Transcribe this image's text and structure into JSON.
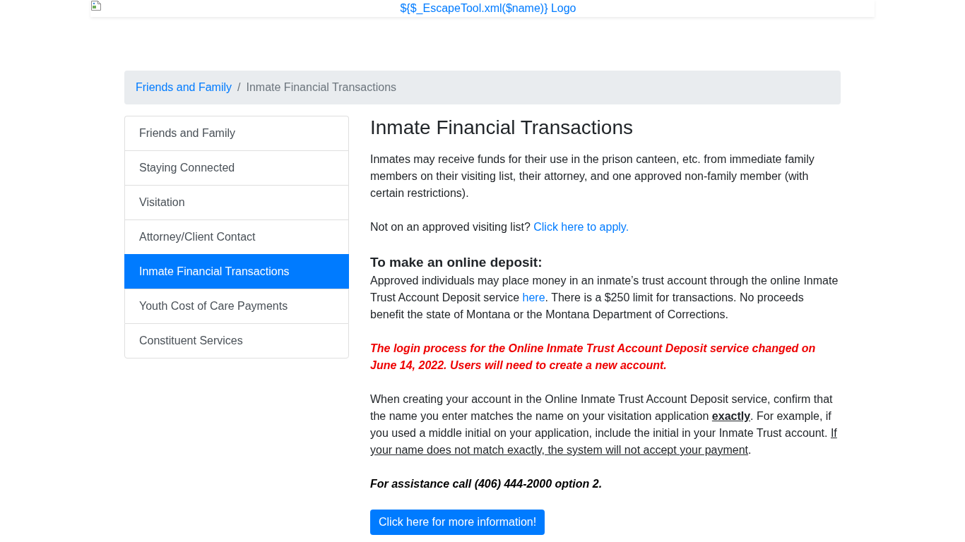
{
  "header": {
    "logo_alt_text": "${$_EscapeTool.xml($name)} Logo"
  },
  "breadcrumb": {
    "separator": "/",
    "items": [
      {
        "label": "Friends and Family",
        "current": false
      },
      {
        "label": "Inmate Financial Transactions",
        "current": true
      }
    ]
  },
  "sidebar": {
    "items": [
      {
        "label": "Friends and Family",
        "selected": false
      },
      {
        "label": "Staying Connected",
        "selected": false
      },
      {
        "label": "Visitation",
        "selected": false
      },
      {
        "label": "Attorney/Client Contact",
        "selected": false
      },
      {
        "label": "Inmate Financial Transactions",
        "selected": true
      },
      {
        "label": "Youth Cost of Care Payments",
        "selected": false
      },
      {
        "label": "Constituent Services",
        "selected": false
      }
    ]
  },
  "content": {
    "title": "Inmate Financial Transactions",
    "blocks": [
      {
        "kind": "paragraph",
        "segments": [
          {
            "kind": "text",
            "text": "Inmates may receive funds for their use in the prison canteen, etc. from immediate family members on their visiting list, their attorney, and one approved non-family member (with certain restrictions)."
          }
        ]
      },
      {
        "kind": "paragraph",
        "segments": [
          {
            "kind": "text",
            "text": "Not on an approved visiting list? "
          },
          {
            "kind": "link",
            "text": "Click here to apply."
          }
        ]
      },
      {
        "kind": "subheading",
        "segments": [
          {
            "kind": "text",
            "text": "To make an online deposit:"
          }
        ]
      },
      {
        "kind": "paragraph",
        "segments": [
          {
            "kind": "text",
            "text": "Approved individuals may place money in an inmate’s trust account through the online Inmate Trust Account Deposit service "
          },
          {
            "kind": "link",
            "text": "here"
          },
          {
            "kind": "text",
            "text": ". There is a $250 limit for transactions. No proceeds benefit the state of Montana or the Montana Department of Corrections."
          }
        ]
      },
      {
        "kind": "warning",
        "segments": [
          {
            "kind": "text",
            "text": "The login process for the Online Inmate Trust Account Deposit service changed on June 14, 2022. Users will need to create a new account."
          }
        ]
      },
      {
        "kind": "paragraph",
        "segments": [
          {
            "kind": "text",
            "text": "When creating your account in the Online Inmate Trust Account Deposit service, confirm that the name you enter matches the name on your visitation application "
          },
          {
            "kind": "strong",
            "text": "exactly"
          },
          {
            "kind": "text",
            "text": ".  For example, if you used a middle initial on your application, include the initial in your Inmate Trust account. "
          },
          {
            "kind": "underlined",
            "text": "If your name does not match exactly, the system will not accept your payment"
          },
          {
            "kind": "text",
            "text": "."
          }
        ]
      },
      {
        "kind": "emphasis",
        "segments": [
          {
            "kind": "text",
            "text": "For assistance call (406) 444-2000 option 2."
          }
        ]
      }
    ],
    "button": "Click here for more information!"
  }
}
